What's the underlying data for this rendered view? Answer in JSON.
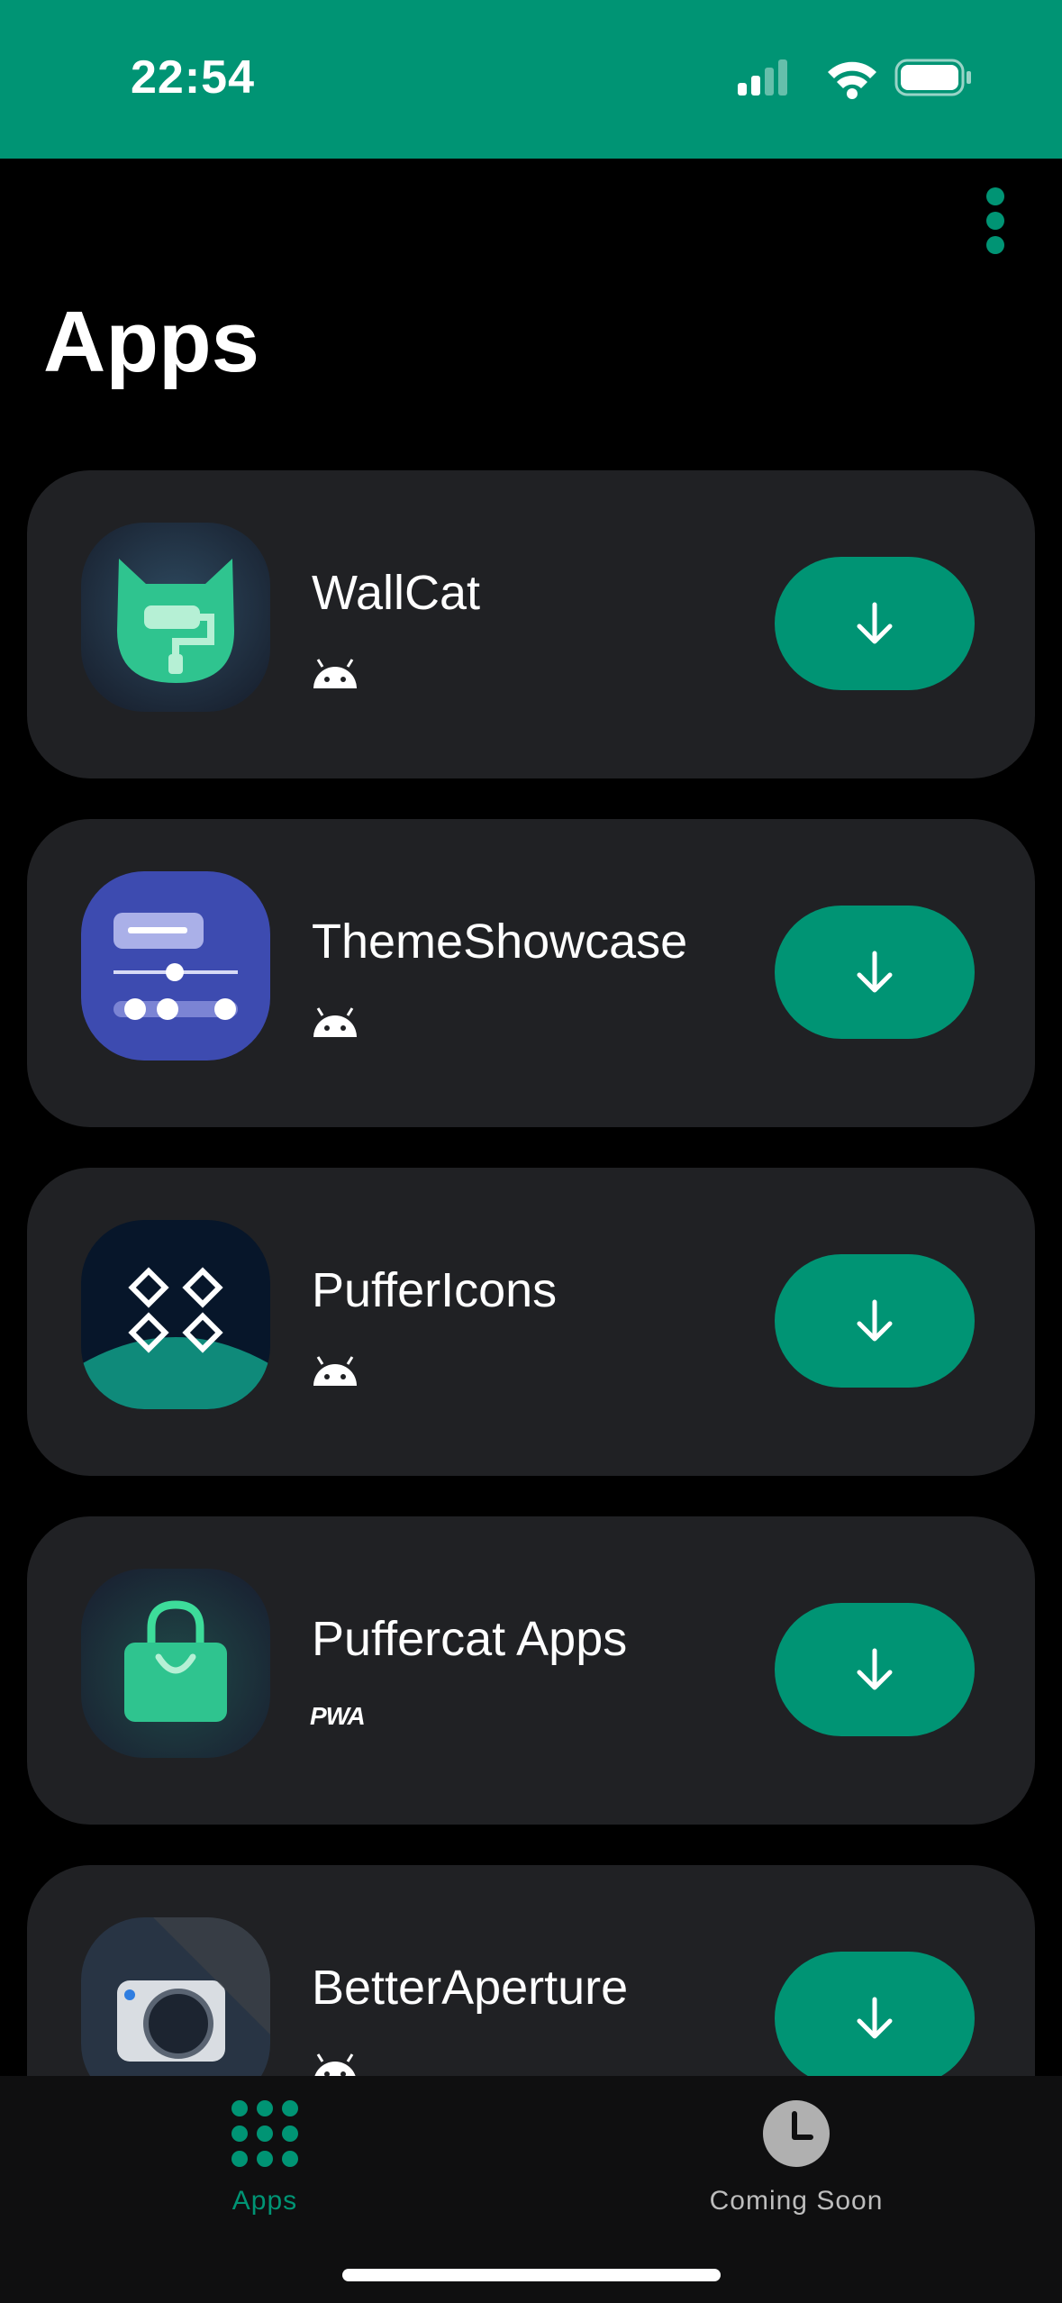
{
  "status_bar": {
    "time": "22:54",
    "bg_color": "#009474"
  },
  "header": {
    "title": "Apps",
    "menu_icon": "more-vertical-icon"
  },
  "apps": [
    {
      "name": "WallCat",
      "platform": "android",
      "icon": "wallcat-app-icon",
      "action_icon": "download-arrow-icon"
    },
    {
      "name": "ThemeShowcase",
      "platform": "android",
      "icon": "themeshowcase-app-icon",
      "action_icon": "download-arrow-icon"
    },
    {
      "name": "PufferIcons",
      "platform": "android",
      "icon": "puffericons-app-icon",
      "action_icon": "download-arrow-icon"
    },
    {
      "name": "Puffercat Apps",
      "platform": "PWA",
      "icon": "puffercat-apps-app-icon",
      "action_icon": "download-arrow-icon"
    },
    {
      "name": "BetterAperture",
      "platform": "android",
      "icon": "betteraperture-app-icon",
      "action_icon": "download-arrow-icon"
    }
  ],
  "tab_bar": {
    "tabs": [
      {
        "label": "Apps",
        "icon": "grid-dots-icon",
        "active": true
      },
      {
        "label": "Coming Soon",
        "icon": "clock-icon",
        "active": false
      }
    ]
  },
  "colors": {
    "accent": "#009474",
    "card": "#202124",
    "background": "#000000",
    "inactive": "#bdbdbd"
  }
}
